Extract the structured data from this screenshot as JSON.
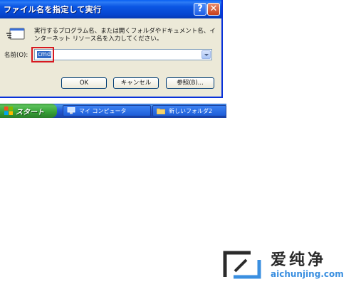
{
  "dialog": {
    "title": "ファイル名を指定して実行",
    "help_glyph": "?",
    "close_glyph": "✕",
    "description": "実行するプログラム名、または開くフォルダやドキュメント名、インターネット リソース名を入力してください。",
    "name_label": "名前(O):",
    "name_value": "cmd",
    "ok_label": "OK",
    "cancel_label": "キャンセル",
    "browse_label": "参照(B)...",
    "icons": {
      "run": "run-icon",
      "dropdown": "chevron-down-icon"
    }
  },
  "taskbar": {
    "start_label": "スタート",
    "tasks": [
      {
        "label": "マイ コンピュータ",
        "icon": "computer-icon"
      },
      {
        "label": "新しいフォルダ2",
        "icon": "folder-icon"
      }
    ]
  },
  "watermark": {
    "cn_text": "爱纯净",
    "url": "aichunjing.com"
  },
  "colors": {
    "titlebar": "#0b56e4",
    "dialog_bg": "#ece9d8",
    "highlight": "#d7181f",
    "start_green": "#36a136",
    "watermark_blue": "#3a8fe0"
  }
}
